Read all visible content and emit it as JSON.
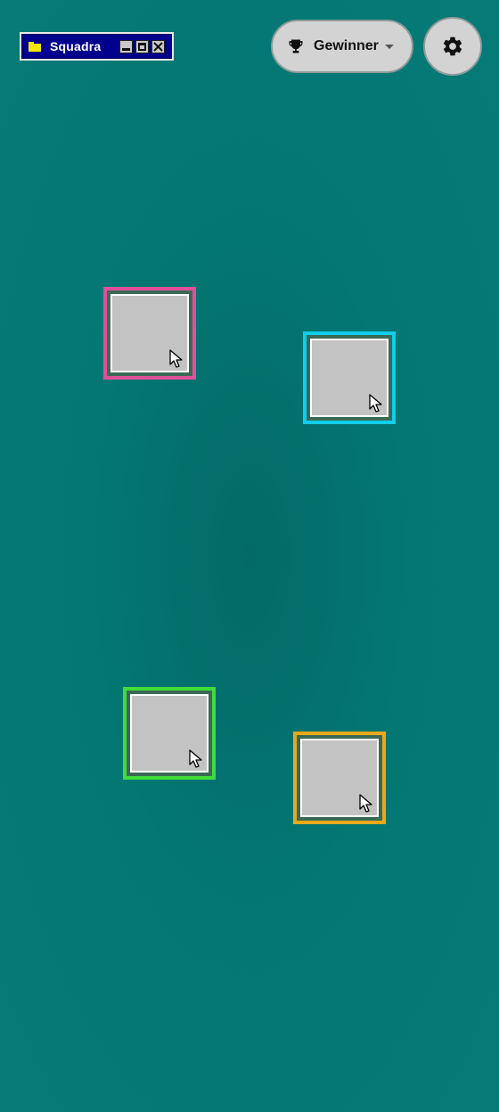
{
  "window": {
    "title": "Squadra",
    "icon": "folder-icon",
    "controls": [
      "minimize-icon",
      "maximize-icon",
      "close-icon"
    ]
  },
  "winners": {
    "label": "Gewinner",
    "icon": "trophy-icon",
    "dropdown_icon": "caret-down-icon"
  },
  "settings": {
    "icon": "gear-icon"
  },
  "players": [
    {
      "color": "#e0509a",
      "icon": "cursor-icon"
    },
    {
      "color": "#10cdea",
      "icon": "cursor-icon"
    },
    {
      "color": "#3fdc3a",
      "icon": "cursor-icon"
    },
    {
      "color": "#e9a81a",
      "icon": "cursor-icon"
    }
  ],
  "colors": {
    "background": "#047773",
    "window_bar": "#00008c",
    "button_bg": "#d3d3d3",
    "tile_fill": "#c3c3c3"
  }
}
